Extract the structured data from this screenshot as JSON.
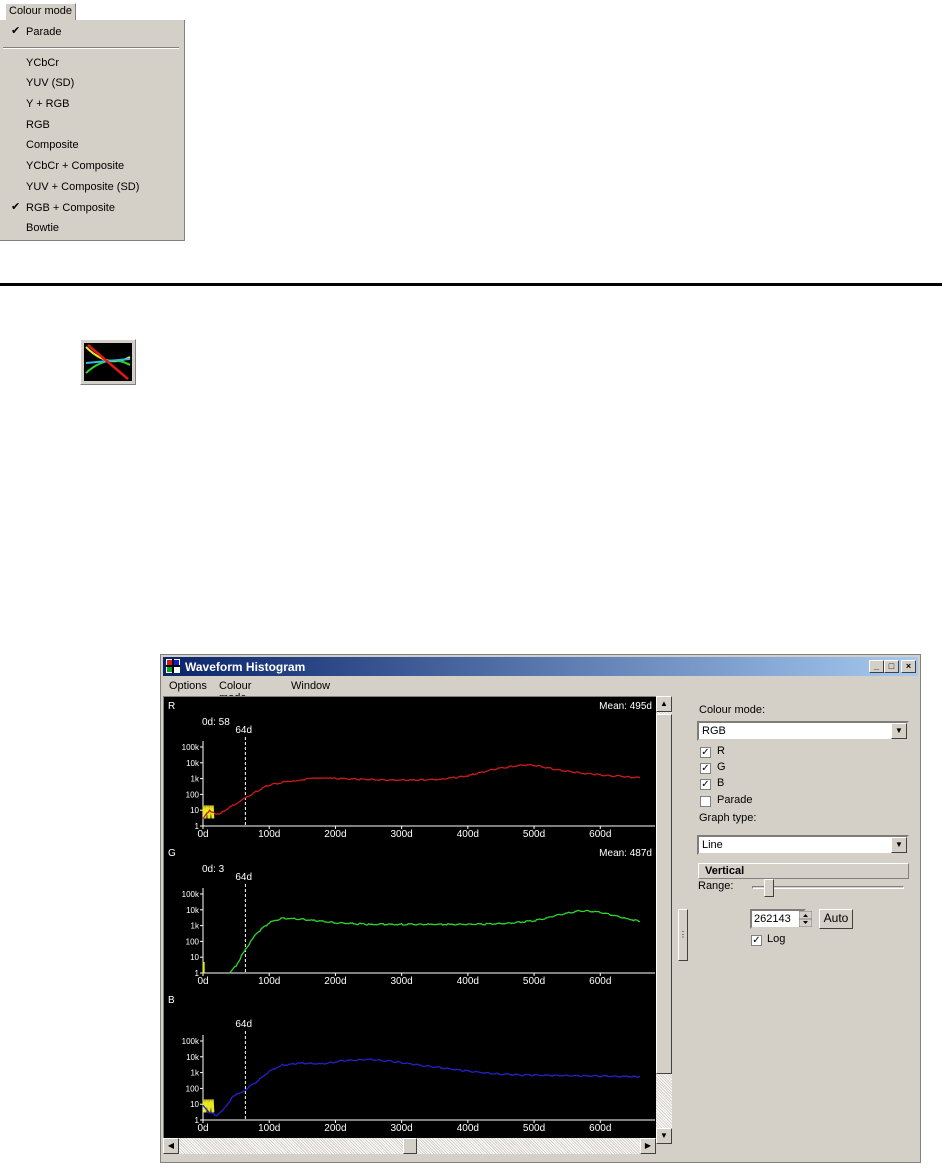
{
  "colour_menu": {
    "title": "Colour mode",
    "items": [
      {
        "label": "Parade",
        "checked": true
      },
      {
        "label": "YCbCr",
        "checked": false
      },
      {
        "label": "YUV (SD)",
        "checked": false
      },
      {
        "label": "Y + RGB",
        "checked": false
      },
      {
        "label": "RGB",
        "checked": false
      },
      {
        "label": "Composite",
        "checked": false
      },
      {
        "label": "YCbCr + Composite",
        "checked": false
      },
      {
        "label": "YUV + Composite (SD)",
        "checked": false
      },
      {
        "label": "RGB + Composite",
        "checked": true
      },
      {
        "label": "Bowtie",
        "checked": false
      }
    ],
    "check_glyph": "✔"
  },
  "toolbar_icon": {
    "name": "waveform-histogram-icon"
  },
  "window": {
    "title": "Waveform Histogram",
    "menubar": [
      "Options",
      "Colour mode",
      "Window"
    ],
    "controls": {
      "minimize": "_",
      "maximize": "□",
      "close": "×"
    }
  },
  "chart_data": [
    {
      "type": "line",
      "panel": "R",
      "title": "R",
      "mean_text": "Mean: 495d",
      "zero_text": "0d: 58",
      "marker_text": "64d",
      "marker_x": 64,
      "color": "#cc1a1a",
      "low_color": "#e8e820",
      "x_ticks": [
        "0d",
        "100d",
        "200d",
        "300d",
        "400d",
        "500d",
        "600d"
      ],
      "y_ticks": [
        "100k",
        "10k",
        "1k",
        "100",
        "10",
        "1"
      ],
      "log_scale": true,
      "xlim": [
        0,
        660
      ],
      "x": [
        0,
        10,
        20,
        30,
        45,
        64,
        80,
        100,
        130,
        165,
        200,
        240,
        280,
        320,
        360,
        400,
        440,
        480,
        500,
        530,
        560,
        600,
        640,
        660
      ],
      "y": [
        3,
        10,
        5,
        8,
        20,
        60,
        150,
        400,
        700,
        1000,
        1000,
        900,
        800,
        800,
        900,
        1500,
        4000,
        7000,
        7000,
        4000,
        2500,
        1700,
        1300,
        1100
      ]
    },
    {
      "type": "line",
      "panel": "G",
      "title": "G",
      "mean_text": "Mean: 487d",
      "zero_text": "0d: 3",
      "marker_text": "64d",
      "marker_x": 64,
      "color": "#2fd52f",
      "low_color": "#e8e820",
      "x_ticks": [
        "0d",
        "100d",
        "200d",
        "300d",
        "400d",
        "500d",
        "600d"
      ],
      "y_ticks": [
        "100k",
        "10k",
        "1k",
        "100",
        "10",
        "1"
      ],
      "log_scale": true,
      "xlim": [
        0,
        660
      ],
      "x": [
        40,
        50,
        64,
        80,
        100,
        120,
        150,
        200,
        250,
        300,
        350,
        400,
        450,
        500,
        540,
        570,
        600,
        630,
        660
      ],
      "y": [
        1,
        3,
        30,
        300,
        1500,
        3000,
        2500,
        1500,
        1200,
        1200,
        1200,
        1200,
        1300,
        2000,
        5000,
        9000,
        7000,
        3500,
        1800
      ]
    },
    {
      "type": "line",
      "panel": "B",
      "title": "B",
      "mean_text": "",
      "zero_text": "",
      "marker_text": "64d",
      "marker_x": 64,
      "color": "#2222cc",
      "low_color": "#e8e820",
      "x_ticks": [
        "0d",
        "100d",
        "200d",
        "300d",
        "400d",
        "500d",
        "600d"
      ],
      "y_ticks": [
        "100k",
        "10k",
        "1k",
        "100",
        "10",
        "1"
      ],
      "log_scale": true,
      "xlim": [
        0,
        660
      ],
      "x": [
        0,
        10,
        20,
        30,
        45,
        64,
        80,
        100,
        120,
        150,
        180,
        210,
        250,
        290,
        330,
        380,
        430,
        480,
        540,
        600,
        660
      ],
      "y": [
        8,
        3,
        2,
        4,
        30,
        80,
        250,
        1200,
        3000,
        4000,
        3500,
        5500,
        7000,
        5000,
        2800,
        1600,
        900,
        700,
        650,
        600,
        550
      ]
    }
  ],
  "side_panel": {
    "colour_mode_label": "Colour mode:",
    "colour_mode_value": "RGB",
    "checks": [
      {
        "label": "R",
        "checked": true
      },
      {
        "label": "G",
        "checked": true
      },
      {
        "label": "B",
        "checked": true
      },
      {
        "label": "Parade",
        "checked": false
      }
    ],
    "graph_type_label": "Graph type:",
    "graph_type_value": "Line",
    "section_header": "Vertical",
    "range_label": "Range:",
    "range_value": "262143",
    "auto_label": "Auto",
    "log_label": "Log",
    "log_checked": true
  }
}
